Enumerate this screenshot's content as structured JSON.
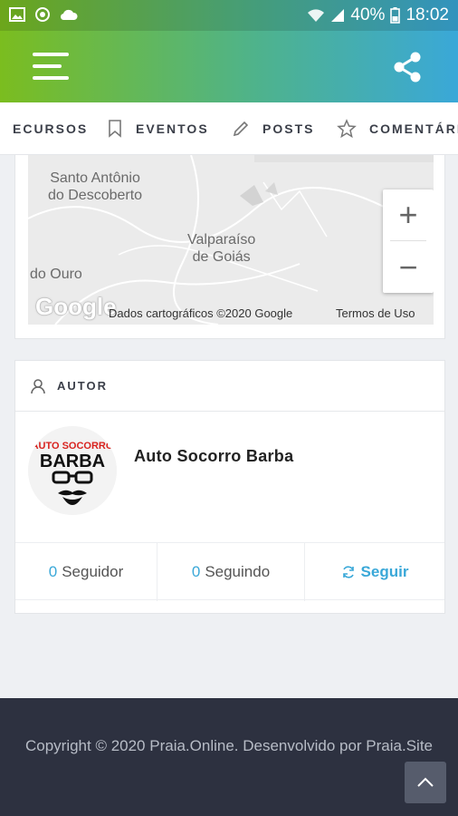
{
  "status_bar": {
    "battery": "40%",
    "time": "18:02"
  },
  "tabs": [
    {
      "label": "ECURSOS",
      "icon": "none"
    },
    {
      "label": "EVENTOS",
      "icon": "bookmark-icon"
    },
    {
      "label": "POSTS",
      "icon": "pencil-icon"
    },
    {
      "label": "COMENTÁRIOS",
      "icon": "star-icon"
    }
  ],
  "map": {
    "labels": [
      "Santo Antônio\ndo Descoberto",
      "Valparaíso\nde Goiás",
      "do Ouro"
    ],
    "logo": "Google",
    "attribution": "Dados cartográficos ©2020 Google",
    "terms": "Termos de Uso",
    "zoom_in": "+",
    "zoom_out": "−"
  },
  "author": {
    "section_label": "AUTOR",
    "name": "Auto Socorro Barba",
    "avatar_text_top": "AUTO SOCORRO",
    "avatar_text_main": "BARBA",
    "followers_count": "0",
    "followers_label": "Seguidor",
    "following_count": "0",
    "following_label": "Seguindo",
    "follow_label": "Seguir"
  },
  "footer": {
    "copyright": "Copyright © 2020 Praia.Online. Desenvolvido por Praia.Site"
  },
  "colors": {
    "accent": "#3aa8d8",
    "header_start": "#7bbd1f",
    "header_end": "#3aa8d8",
    "footer_bg": "#2d3140"
  }
}
